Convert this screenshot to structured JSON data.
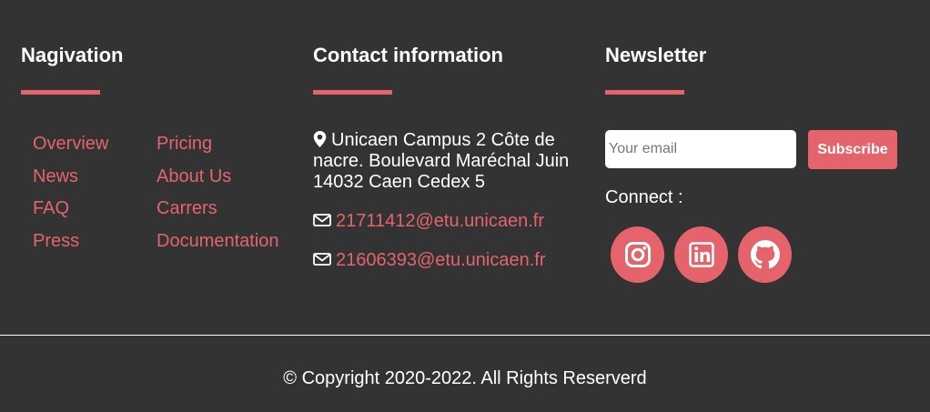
{
  "navigation": {
    "heading": "Nagivation",
    "links_left": [
      "Overview",
      "News",
      "FAQ",
      "Press"
    ],
    "links_right": [
      "Pricing",
      "About Us",
      "Carrers",
      "Documentation"
    ]
  },
  "contact": {
    "heading": "Contact information",
    "address": "Unicaen Campus 2 Côte de nacre. Boulevard Maréchal Juin 14032 Caen Cedex 5",
    "emails": [
      "21711412@etu.unicaen.fr",
      "21606393@etu.unicaen.fr"
    ]
  },
  "newsletter": {
    "heading": "Newsletter",
    "email_placeholder": "Your email",
    "subscribe_label": "Subscribe",
    "connect_label": "Connect :",
    "social_icons": [
      "instagram-icon",
      "linkedin-icon",
      "github-icon"
    ]
  },
  "footer": {
    "copyright": "© Copyright 2020-2022. All Rights Reserverd"
  },
  "colors": {
    "background": "#333333",
    "accent": "#e5646c",
    "text": "#ffffff"
  }
}
